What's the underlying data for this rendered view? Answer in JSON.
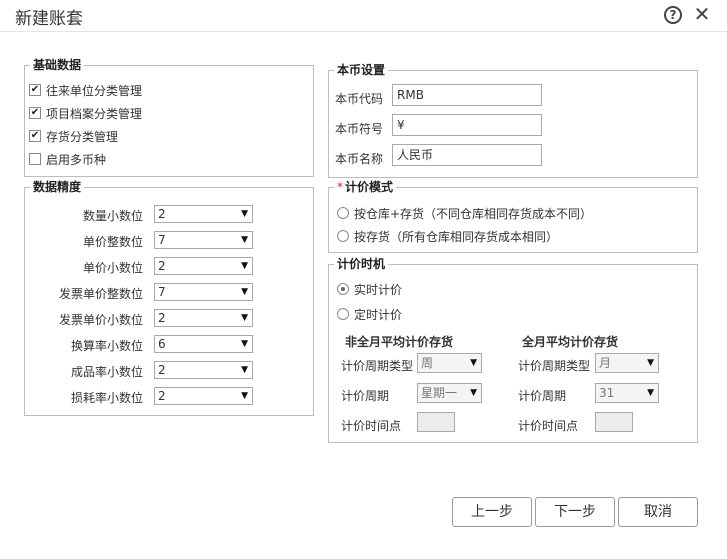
{
  "dialog": {
    "title": "新建账套"
  },
  "basic_data": {
    "legend": "基础数据",
    "items": [
      {
        "label": "往来单位分类管理",
        "checked": true
      },
      {
        "label": "项目档案分类管理",
        "checked": true
      },
      {
        "label": "存货分类管理",
        "checked": true
      },
      {
        "label": "启用多币种",
        "checked": false
      }
    ]
  },
  "precision": {
    "legend": "数据精度",
    "rows": [
      {
        "label": "数量小数位",
        "value": "2"
      },
      {
        "label": "单价整数位",
        "value": "7"
      },
      {
        "label": "单价小数位",
        "value": "2"
      },
      {
        "label": "发票单价整数位",
        "value": "7"
      },
      {
        "label": "发票单价小数位",
        "value": "2"
      },
      {
        "label": "换算率小数位",
        "value": "6"
      },
      {
        "label": "成品率小数位",
        "value": "2"
      },
      {
        "label": "损耗率小数位",
        "value": "2"
      }
    ]
  },
  "currency": {
    "legend": "本币设置",
    "code_label": "本币代码",
    "code_value": "RMB",
    "symbol_label": "本币符号",
    "symbol_value": "¥",
    "name_label": "本币名称",
    "name_value": "人民币"
  },
  "pricing_mode": {
    "required_mark": "*",
    "legend": "计价模式",
    "options": [
      {
        "label": "按仓库+存货（不同仓库相同存货成本不同）",
        "selected": false
      },
      {
        "label": "按存货（所有仓库相同存货成本相同）",
        "selected": false
      }
    ]
  },
  "pricing_timing": {
    "legend": "计价时机",
    "realtime_label": "实时计价",
    "realtime_selected": true,
    "scheduled_label": "定时计价",
    "scheduled_selected": false,
    "non_monthly": {
      "heading": "非全月平均计价存货",
      "period_type_label": "计价周期类型",
      "period_type_value": "周",
      "period_label": "计价周期",
      "period_value": "星期一",
      "time_label": "计价时间点"
    },
    "monthly": {
      "heading": "全月平均计价存货",
      "period_type_label": "计价周期类型",
      "period_type_value": "月",
      "period_label": "计价周期",
      "period_value": "31",
      "time_label": "计价时间点"
    }
  },
  "buttons": {
    "prev": "上一步",
    "next": "下一步",
    "cancel": "取消"
  },
  "icons": {
    "dropdown": "▼",
    "check": "✔"
  }
}
